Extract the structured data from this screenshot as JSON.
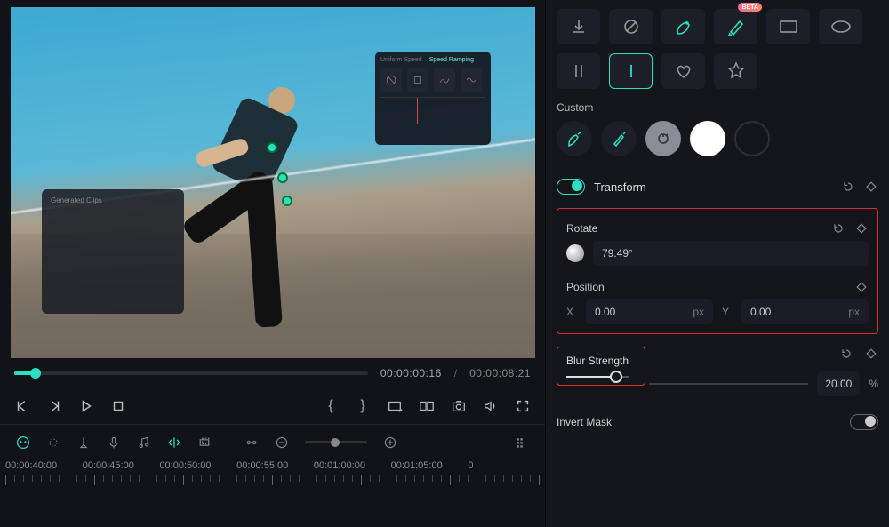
{
  "shapes_row1": [
    "download",
    "none",
    "pen",
    "marker",
    "rect"
  ],
  "shapes_row2": [
    "ellipse",
    "dbl-line",
    "single-line",
    "heart",
    "star"
  ],
  "shapes_badge": "BETA",
  "custom_label": "Custom",
  "transform": {
    "title": "Transform",
    "rotate_label": "Rotate",
    "rotate_value": "79.49°",
    "position_label": "Position",
    "x_label": "X",
    "x_value": "0.00",
    "x_unit": "px",
    "y_label": "Y",
    "y_value": "0.00",
    "y_unit": "px"
  },
  "blur": {
    "label": "Blur Strength",
    "value": "20.00",
    "unit": "%",
    "percent": 20
  },
  "invert_mask_label": "Invert Mask",
  "playback": {
    "current": "00:00:00:16",
    "total": "00:00:08:21"
  },
  "timeline": {
    "labels": [
      "00:00:40:00",
      "00:00:45:00",
      "00:00:50:00",
      "00:00:55:00",
      "00:01:00:00",
      "00:01:05:00",
      "0"
    ]
  },
  "overlay1": {
    "tab1": "Uniform Speed",
    "tab2": "Speed Ramping"
  },
  "overlay2": {
    "hdr": "Generated Clips"
  }
}
